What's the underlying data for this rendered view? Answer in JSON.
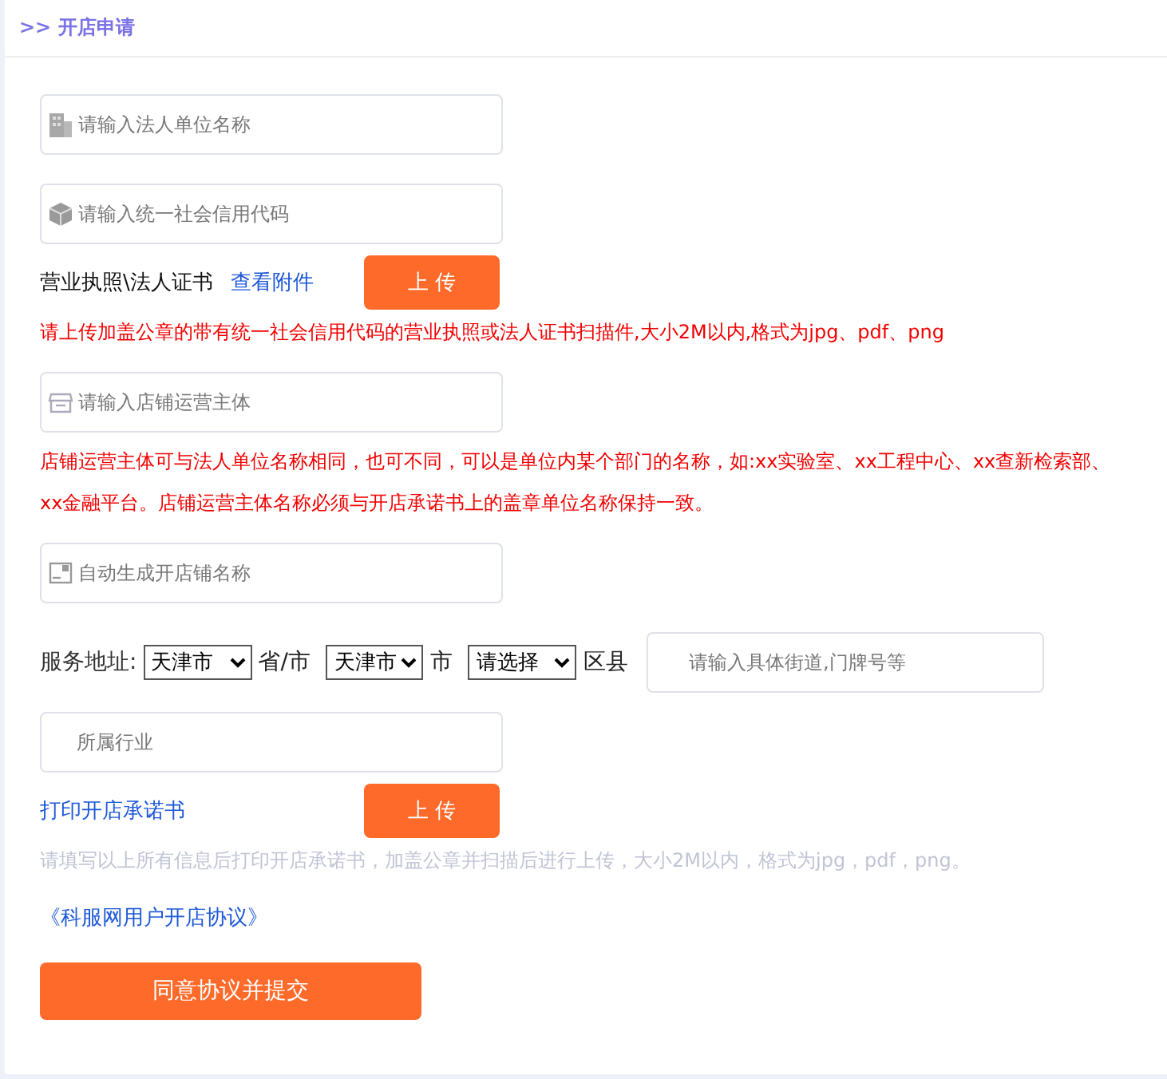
{
  "header": {
    "title": ">> 开店申请"
  },
  "rows": [
    {
      "kind": "company_field",
      "placeholder": "请输入法人单位名称"
    },
    {
      "kind": "code_field",
      "placeholder": "请输入统一社会信用代码"
    },
    {
      "kind": "upload",
      "label": "营业执照\\法人证书",
      "link": "查看附件",
      "button": "上 传"
    },
    {
      "kind": "warning",
      "text": "请上传加盖公章的带有统一社会信用代码的营业执照或法人证书扫描件,大小2M以内,格式为jpg、pdf、png"
    },
    {
      "kind": "store_field",
      "placeholder": "请输入店铺运营主体"
    },
    {
      "kind": "warning",
      "text": "店铺运营主体可与法人单位名称相同，也可不同，可以是单位内某个部门的名称，如:xx实验室、xx工程中心、xx查新检索部、xx金融平台。店铺运营主体名称必须与开店承诺书上的盖章单位名称保持一致。"
    },
    {
      "kind": "name_field",
      "placeholder": "自动生成开店铺名称"
    },
    {
      "kind": "address",
      "label": "服务地址:",
      "selects": [
        {
          "value": "天津市",
          "suffix": "省/市"
        },
        {
          "value": "天津市",
          "suffix": "市"
        },
        {
          "value": "请选择",
          "suffix": "区县"
        }
      ],
      "placeholder": "请输入具体街道,门牌号等"
    },
    {
      "kind": "field",
      "placeholder": "所属行业"
    },
    {
      "kind": "upload",
      "link": "打印开店承诺书",
      "button": "上 传"
    },
    {
      "kind": "hint",
      "text": "请填写以上所有信息后打印开店承诺书，加盖公章并扫描后进行上传，大小2M以内，格式为jpg，pdf，png。"
    },
    {
      "kind": "agreement",
      "link": "《科服网用户开店协议》"
    },
    {
      "kind": "submit",
      "button": "同意协议并提交"
    }
  ]
}
